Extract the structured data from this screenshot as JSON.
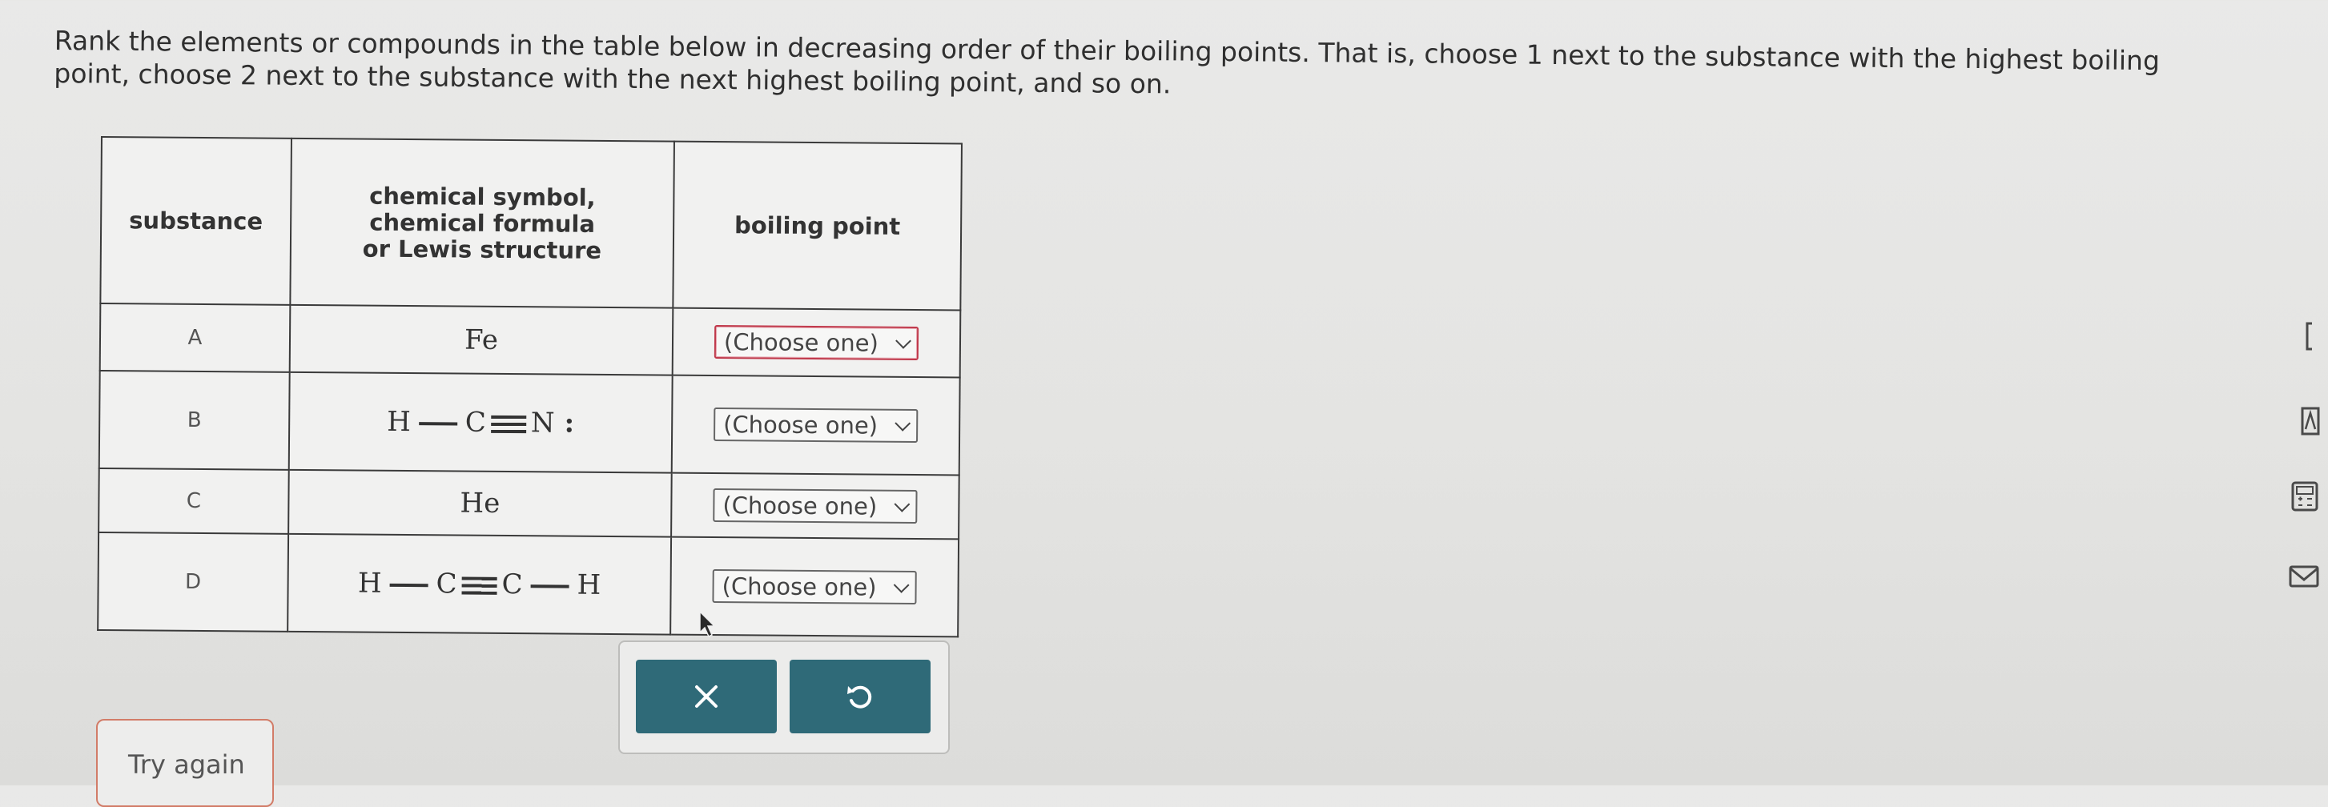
{
  "prompt": {
    "line1": "Rank the elements or compounds in the table below in decreasing order of their boiling points. That is, choose 1 next to the substance with the highest boiling",
    "line2": "point, choose 2 next to the substance with the next highest boiling point, and so on."
  },
  "table": {
    "headers": {
      "substance": "substance",
      "formula_l1": "chemical symbol,",
      "formula_l2": "chemical formula",
      "formula_l3": "or Lewis structure",
      "boiling": "boiling point"
    },
    "rows": [
      {
        "letter": "A",
        "formula": "Fe",
        "select": "(Choose one)"
      },
      {
        "letter": "B",
        "atoms": [
          "H",
          "C",
          "N"
        ],
        "lone_pair": ":",
        "select": "(Choose one)"
      },
      {
        "letter": "C",
        "formula": "He",
        "select": "(Choose one)"
      },
      {
        "letter": "D",
        "atoms": [
          "H",
          "C",
          "C",
          "H"
        ],
        "select": "(Choose one)"
      }
    ]
  },
  "actions": {
    "clear_icon": "x-icon",
    "undo_icon": "undo-icon"
  },
  "try_again": "Try again",
  "colors": {
    "accent": "#2f6a78",
    "error": "#c0394b",
    "try_again_border": "#d27c68"
  }
}
